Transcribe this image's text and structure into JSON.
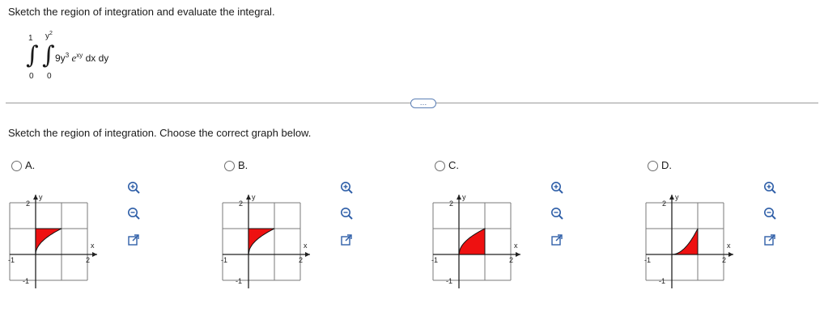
{
  "prompt": "Sketch the region of integration and evaluate the integral.",
  "integral": {
    "outer_upper": "1",
    "outer_lower": "0",
    "inner_upper_base": "y",
    "inner_upper_exp": "2",
    "inner_lower": "0",
    "coef": "9y",
    "coef_exp": "3",
    "exp_base": "e",
    "exp_power": "xy",
    "differentials": "dx dy"
  },
  "expand_button": "…",
  "question": "Sketch the region of integration. Choose the correct graph below.",
  "options": [
    {
      "label": "A.",
      "variant": "a"
    },
    {
      "label": "B.",
      "variant": "b"
    },
    {
      "label": "C.",
      "variant": "c"
    },
    {
      "label": "D.",
      "variant": "d"
    }
  ],
  "graph_labels": {
    "y_axis": "y",
    "x_axis": "x",
    "y_max": "2",
    "x_max": "2",
    "x_min": "-1",
    "y_min": "-1"
  },
  "colors": {
    "region_fill": "#ee1111",
    "region_stroke": "#111111",
    "grid": "#7a7a7a",
    "tool_blue": "#2f5fa8"
  },
  "tools": [
    "zoom-in-icon",
    "zoom-out-icon",
    "open-in-window-icon"
  ]
}
